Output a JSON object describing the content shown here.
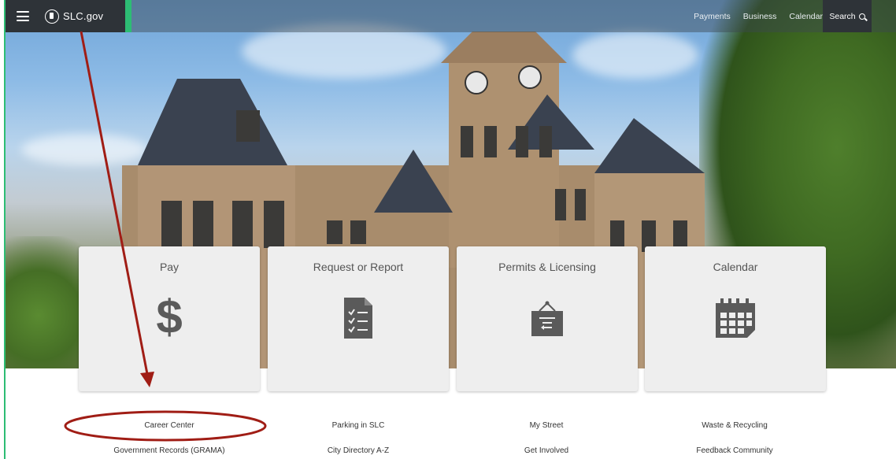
{
  "header": {
    "brand": "SLC.gov",
    "nav": [
      "Payments",
      "Business",
      "Calendar"
    ],
    "search_label": "Search"
  },
  "cards": [
    {
      "title": "Pay",
      "icon": "dollar-icon"
    },
    {
      "title": "Request or Report",
      "icon": "checklist-icon"
    },
    {
      "title": "Permits & Licensing",
      "icon": "permit-sign-icon"
    },
    {
      "title": "Calendar",
      "icon": "calendar-icon"
    }
  ],
  "links": {
    "row1": [
      "Career Center",
      "Parking in SLC",
      "My Street",
      "Waste & Recycling"
    ],
    "row2": [
      "Government Records (GRAMA)",
      "City Directory A-Z",
      "Get Involved",
      "Feedback Community"
    ]
  },
  "colors": {
    "accent": "#2dbd74",
    "annotation": "#a01d15",
    "card_bg": "#eeeeee",
    "icon": "#5a5a5a"
  }
}
